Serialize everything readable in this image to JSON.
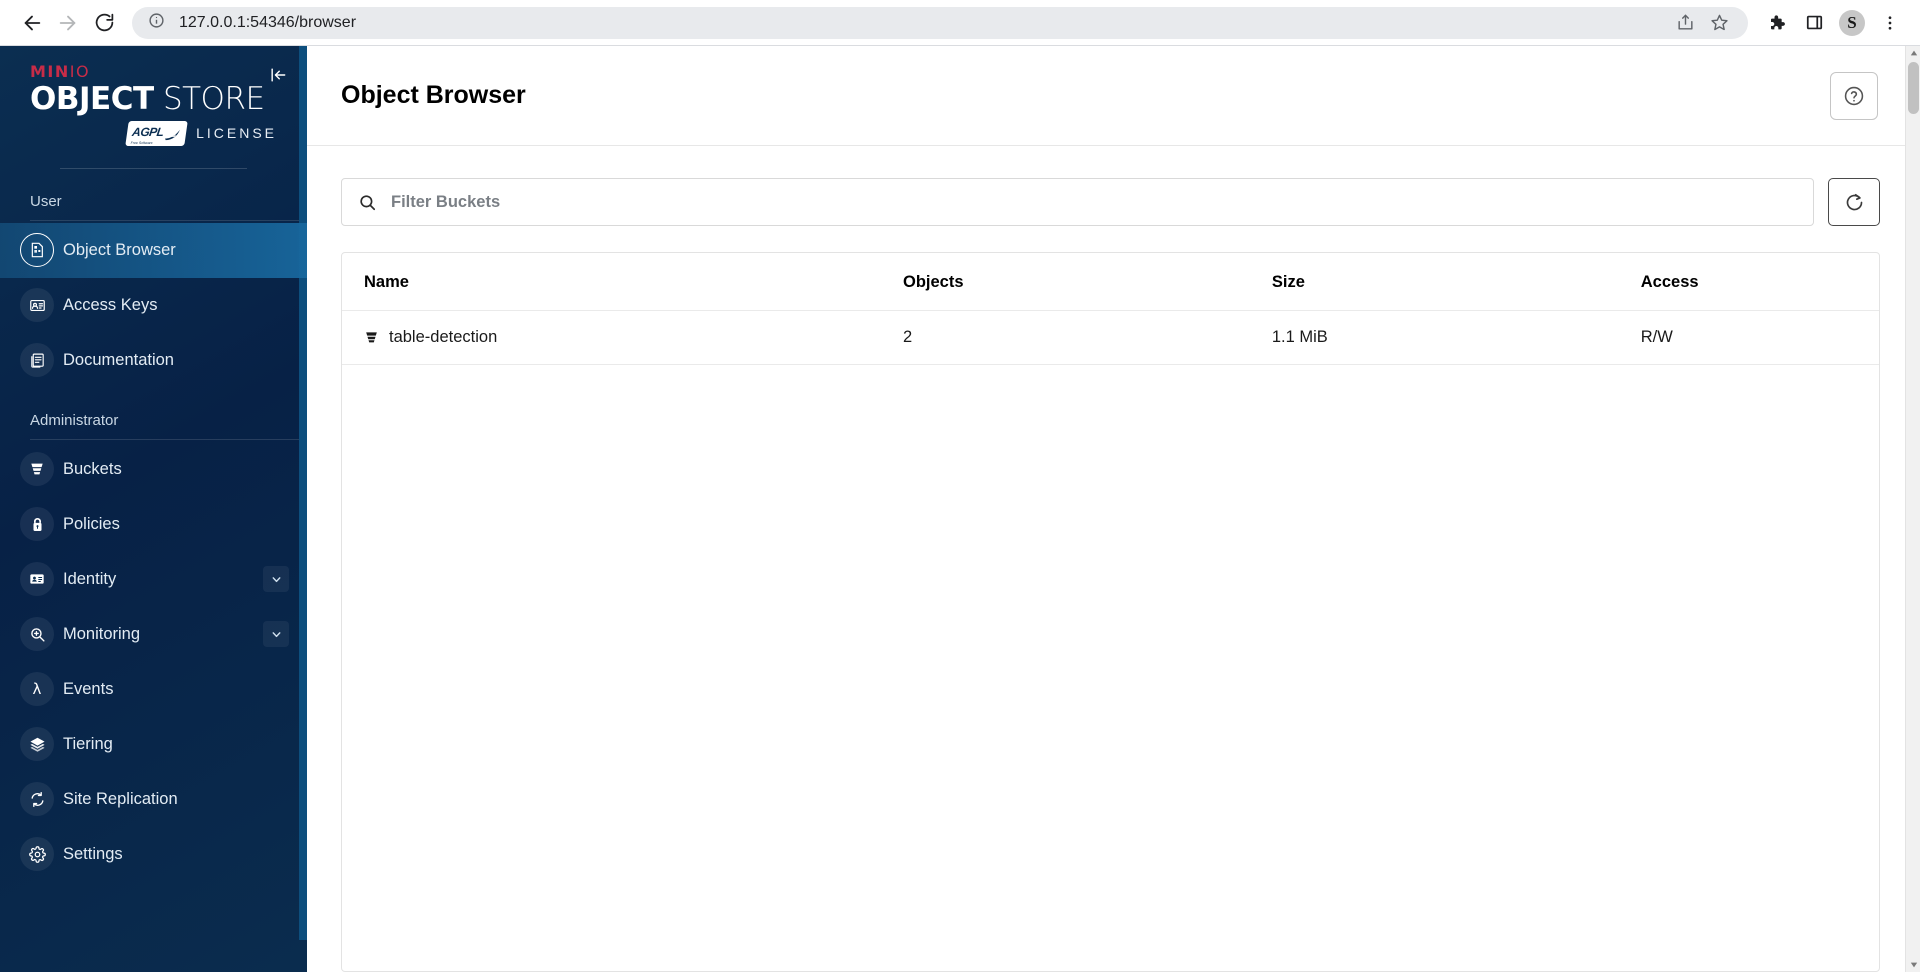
{
  "browser": {
    "url": "127.0.0.1:54346/browser",
    "back_label": "Back",
    "forward_label": "Forward",
    "reload_label": "Reload",
    "site_info_label": "View site information",
    "share_label": "Share this page",
    "bookmark_label": "Bookmark this tab",
    "extensions_label": "Extensions",
    "side_panel_label": "Side panel",
    "profile_initial": "S",
    "menu_label": "Customize and control Google Chrome"
  },
  "sidebar": {
    "logo": {
      "brand": "MIN",
      "brand_suffix": "IO",
      "product_bold": "OBJECT",
      "product_light": " STORE",
      "license_badge": "AGPL",
      "license_badge_sub": "Free Software",
      "license_word": "LICENSE"
    },
    "collapse_label": "Collapse sidebar",
    "sections": [
      {
        "label": "User",
        "items": [
          {
            "label": "Object Browser",
            "icon": "object-browser-icon",
            "active": true
          },
          {
            "label": "Access Keys",
            "icon": "access-keys-icon",
            "active": false
          },
          {
            "label": "Documentation",
            "icon": "documentation-icon",
            "active": false
          }
        ]
      },
      {
        "label": "Administrator",
        "items": [
          {
            "label": "Buckets",
            "icon": "bucket-icon",
            "active": false
          },
          {
            "label": "Policies",
            "icon": "lock-icon",
            "active": false
          },
          {
            "label": "Identity",
            "icon": "identity-card-icon",
            "active": false,
            "expandable": true
          },
          {
            "label": "Monitoring",
            "icon": "monitoring-magnifier-icon",
            "active": false,
            "expandable": true
          },
          {
            "label": "Events",
            "icon": "lambda-icon",
            "active": false
          },
          {
            "label": "Tiering",
            "icon": "layers-icon",
            "active": false
          },
          {
            "label": "Site Replication",
            "icon": "replication-icon",
            "active": false
          },
          {
            "label": "Settings",
            "icon": "gear-icon",
            "active": false
          }
        ]
      }
    ]
  },
  "page": {
    "title": "Object Browser",
    "help_label": "Help"
  },
  "search": {
    "placeholder": "Filter Buckets",
    "value": "",
    "icon": "search-icon"
  },
  "refresh": {
    "label": "Refresh",
    "icon": "refresh-icon"
  },
  "table": {
    "columns": [
      "Name",
      "Objects",
      "Size",
      "Access"
    ],
    "rows": [
      {
        "name": "table-detection",
        "objects": "2",
        "size": "1.1 MiB",
        "access": "R/W",
        "icon": "bucket-icon"
      }
    ]
  },
  "colors": {
    "sidebar_bg": "#072146",
    "sidebar_active": "#18679d",
    "brand_red": "#c72c48",
    "accent_scroll": "#0d4e7d"
  }
}
